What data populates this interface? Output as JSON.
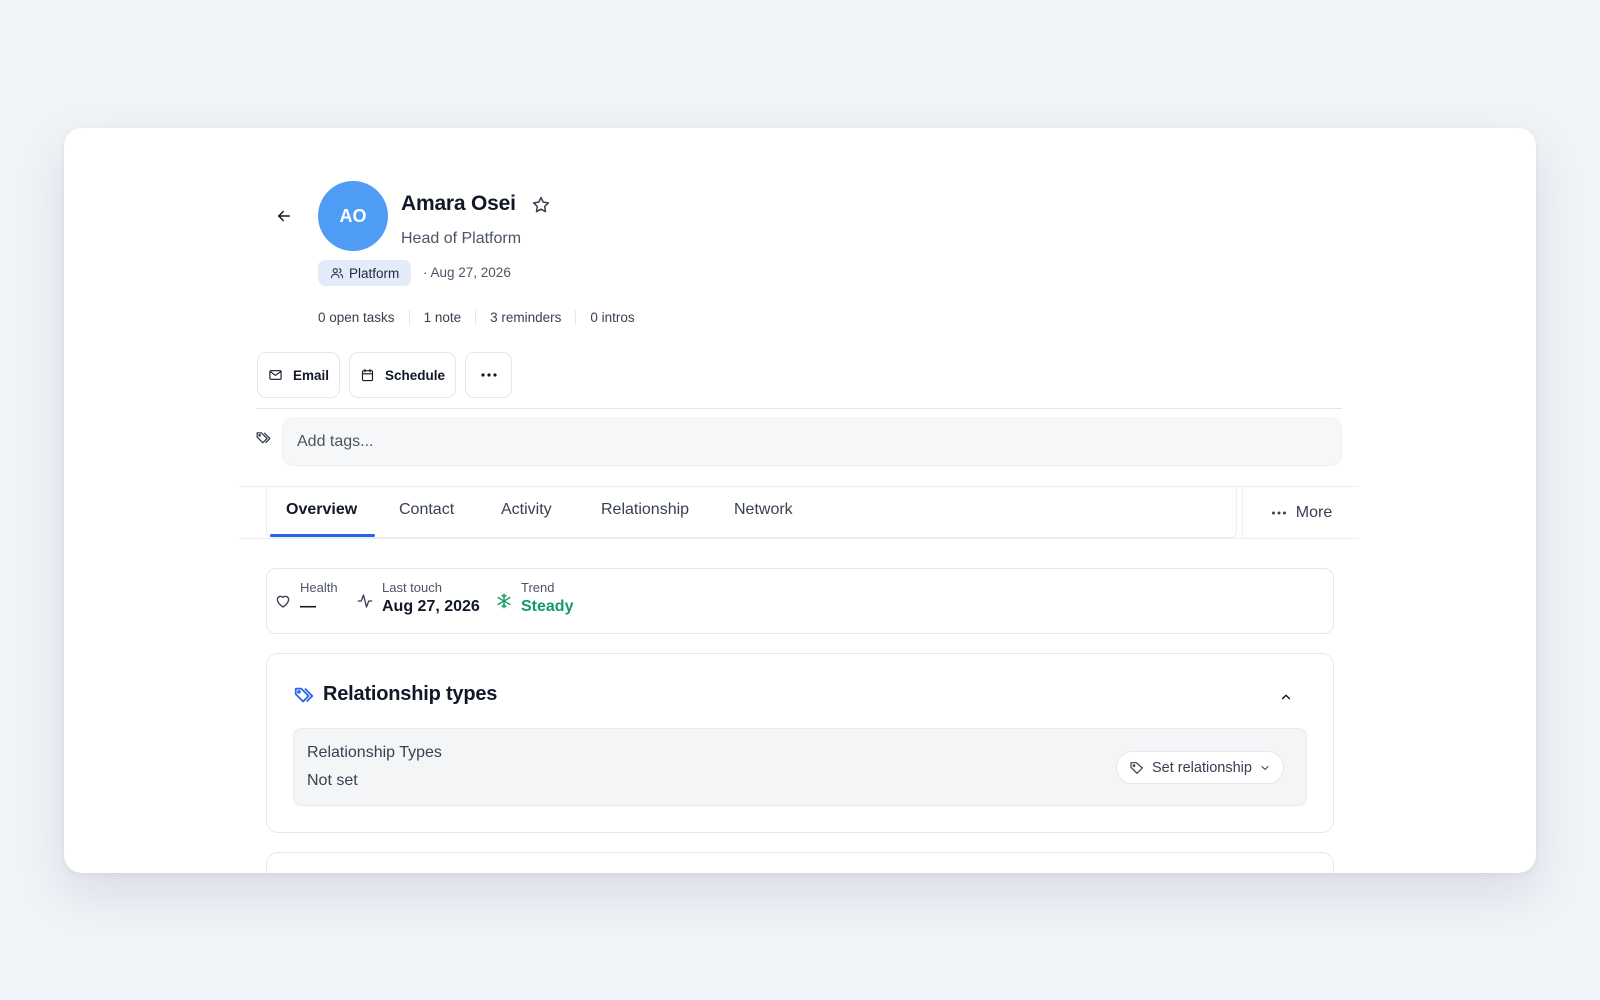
{
  "contact": {
    "name": "Amara Osei",
    "initials": "AO",
    "title": "Head of Platform",
    "team": "Platform",
    "date_meta": "· Aug 27, 2026",
    "avatar_color": "#4f9cf5"
  },
  "stats": {
    "open_tasks": "0 open tasks",
    "notes": "1 note",
    "reminders": "3 reminders",
    "intros": "0 intros"
  },
  "actions": {
    "email_label": "Email",
    "schedule_label": "Schedule"
  },
  "tags": {
    "placeholder": "Add tags..."
  },
  "tabs": [
    {
      "label": "Overview",
      "active": true
    },
    {
      "label": "Contact",
      "active": false
    },
    {
      "label": "Activity",
      "active": false
    },
    {
      "label": "Relationship",
      "active": false
    },
    {
      "label": "Network",
      "active": false
    }
  ],
  "more_label": "More",
  "metrics": {
    "health_label": "Health",
    "health_value": "—",
    "last_touch_label": "Last touch",
    "last_touch_value": "Aug 27, 2026",
    "trend_label": "Trend",
    "trend_value": "Steady",
    "trend_color": "#0f9d63"
  },
  "relationship": {
    "section_title": "Relationship types",
    "field_label": "Relationship Types",
    "field_value": "Not set",
    "set_button": "Set relationship"
  },
  "colors": {
    "accent": "#2563eb",
    "background": "#f0f3f8"
  }
}
